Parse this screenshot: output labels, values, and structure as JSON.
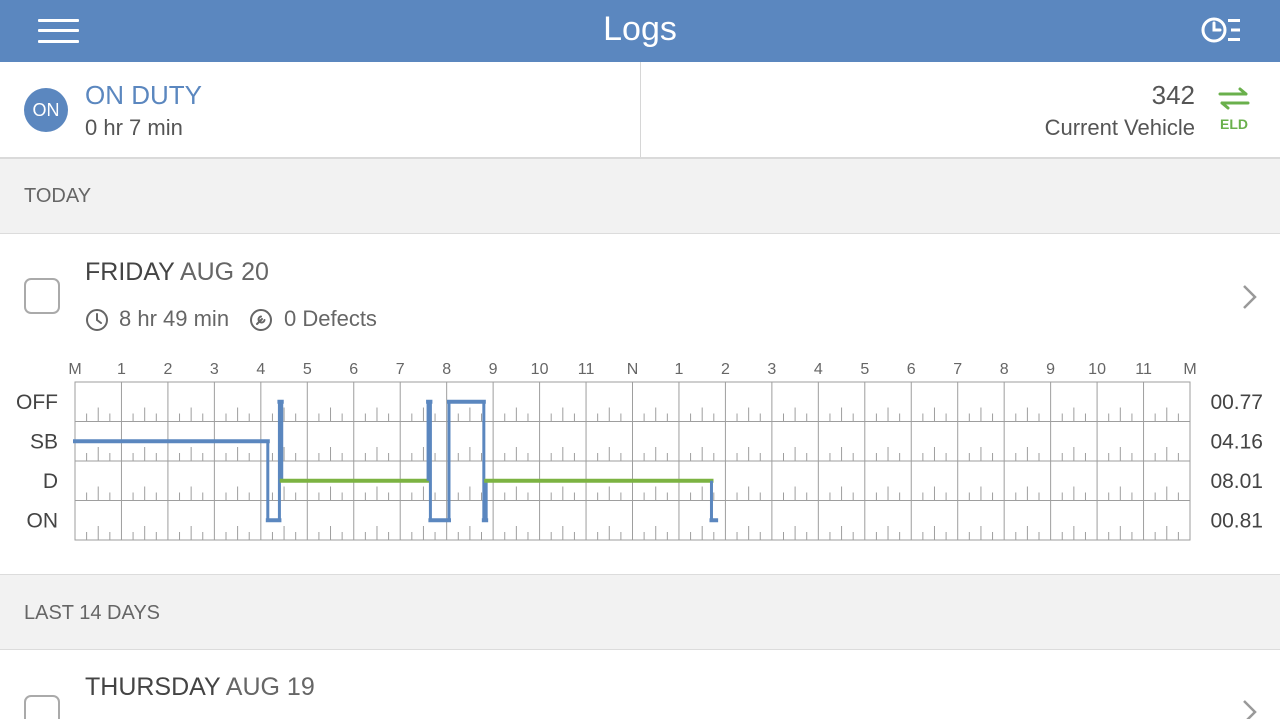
{
  "header": {
    "title": "Logs",
    "menu_icon": "hamburger-menu-icon",
    "hos_icon": "clock-list-icon"
  },
  "status": {
    "badge": "ON",
    "title": "ON DUTY",
    "duration": "0 hr 7 min"
  },
  "vehicle": {
    "number": "342",
    "label": "Current Vehicle",
    "eld_label": "ELD",
    "eld_icon": "swap-arrows-icon"
  },
  "sections": {
    "today": "TODAY",
    "last14": "LAST 14 DAYS"
  },
  "logs": [
    {
      "day": "FRIDAY",
      "date": "AUG 20",
      "duration": "8 hr 49 min",
      "defects": "0 Defects",
      "duration_icon": "clock-icon",
      "defects_icon": "wrench-icon"
    },
    {
      "day": "THURSDAY",
      "date": "AUG 19"
    }
  ],
  "chart_data": {
    "type": "duty-status-grid",
    "hour_labels": [
      "M",
      "1",
      "2",
      "3",
      "4",
      "5",
      "6",
      "7",
      "8",
      "9",
      "10",
      "11",
      "N",
      "1",
      "2",
      "3",
      "4",
      "5",
      "6",
      "7",
      "8",
      "9",
      "10",
      "11",
      "M"
    ],
    "rows": [
      "OFF",
      "SB",
      "D",
      "ON"
    ],
    "totals": [
      "00.77",
      "04.16",
      "08.01",
      "00.81"
    ],
    "segments": [
      {
        "status": "SB",
        "start": 0.0,
        "end": 4.15
      },
      {
        "status": "ON",
        "start": 4.15,
        "end": 4.4
      },
      {
        "status": "OFF",
        "start": 4.4,
        "end": 4.45
      },
      {
        "status": "D",
        "start": 4.45,
        "end": 7.6
      },
      {
        "status": "OFF",
        "start": 7.6,
        "end": 7.65
      },
      {
        "status": "ON",
        "start": 7.65,
        "end": 8.05
      },
      {
        "status": "OFF",
        "start": 8.05,
        "end": 8.8
      },
      {
        "status": "ON",
        "start": 8.8,
        "end": 8.85
      },
      {
        "status": "D",
        "start": 8.85,
        "end": 13.7
      },
      {
        "status": "ON",
        "start": 13.7,
        "end": 13.8
      }
    ],
    "colors": {
      "line": "#5b87bf",
      "driving": "#7cb342",
      "grid": "#9e9e9e"
    }
  }
}
